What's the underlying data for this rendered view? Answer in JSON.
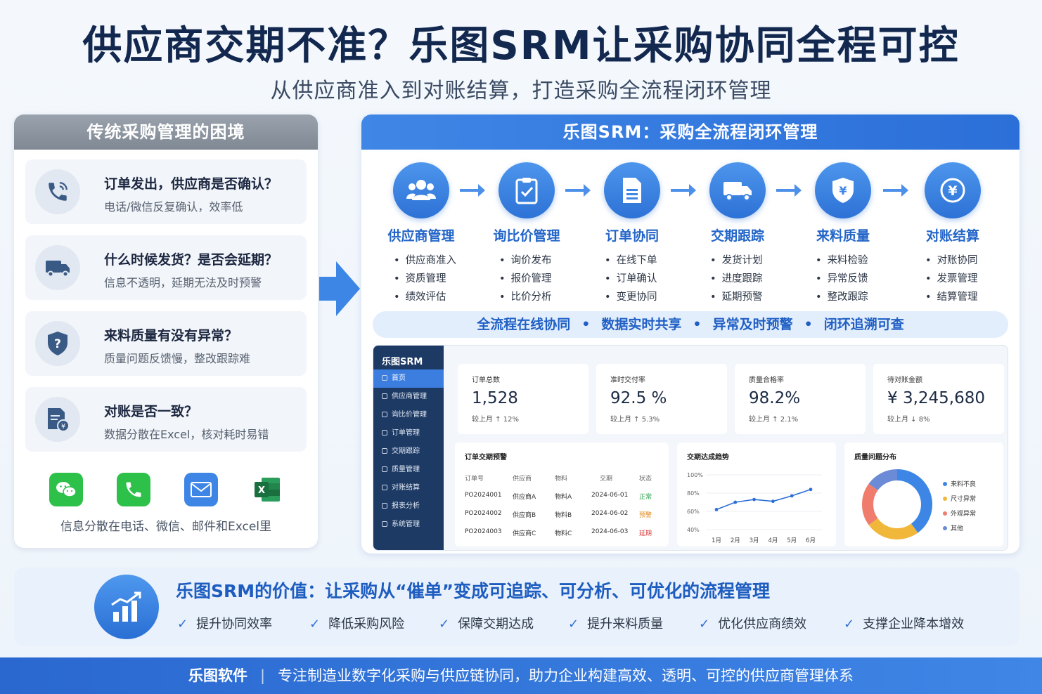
{
  "title": "供应商交期不准？乐图SRM让采购协同全程可控",
  "subtitle": "从供应商准入到对账结算，打造采购全流程闭环管理",
  "left": {
    "header": "传统采购管理的困境",
    "items": [
      {
        "title": "订单发出，供应商是否确认？",
        "desc": "电话/微信反复确认，效率低",
        "icon": "phone-icon"
      },
      {
        "title": "什么时候发货？是否会延期？",
        "desc": "信息不透明，延期无法及时预警",
        "icon": "truck-icon"
      },
      {
        "title": "来料质量有没有异常？",
        "desc": "质量问题反馈慢，整改跟踪难",
        "icon": "shield-question-icon"
      },
      {
        "title": "对账是否一致？",
        "desc": "数据分散在Excel，核对耗时易错",
        "icon": "invoice-icon"
      }
    ],
    "apps_caption": "信息分散在电话、微信、邮件和Excel里",
    "apps": [
      {
        "name": "wechat-icon",
        "color": "#2dc14a"
      },
      {
        "name": "phone-app-icon",
        "color": "#2dc14a"
      },
      {
        "name": "mail-icon",
        "color": "#3d86e6"
      },
      {
        "name": "excel-icon",
        "color": "#1f7a45"
      }
    ]
  },
  "right": {
    "header": "乐图SRM：采购全流程闭环管理",
    "steps": [
      {
        "name": "供应商管理",
        "icon": "users-icon",
        "items": [
          "供应商准入",
          "资质管理",
          "绩效评估"
        ]
      },
      {
        "name": "询比价管理",
        "icon": "clipboard-check-icon",
        "items": [
          "询价发布",
          "报价管理",
          "比价分析"
        ]
      },
      {
        "name": "订单协同",
        "icon": "document-icon",
        "items": [
          "在线下单",
          "订单确认",
          "变更协同"
        ]
      },
      {
        "name": "交期跟踪",
        "icon": "truck-icon",
        "items": [
          "发货计划",
          "进度跟踪",
          "延期预警"
        ]
      },
      {
        "name": "来料质量",
        "icon": "shield-yen-icon",
        "items": [
          "来料检验",
          "异常反馈",
          "整改跟踪"
        ]
      },
      {
        "name": "对账结算",
        "icon": "yen-icon",
        "items": [
          "对账协同",
          "发票管理",
          "结算管理"
        ]
      }
    ],
    "features": [
      "全流程在线协同",
      "数据实时共享",
      "异常及时预警",
      "闭环追溯可查"
    ],
    "feature_sep": "•"
  },
  "dashboard": {
    "logo": "乐图SRM",
    "nav": [
      "首页",
      "供应商管理",
      "询比价管理",
      "订单管理",
      "交期跟踪",
      "质量管理",
      "对账结算",
      "报表分析",
      "系统管理"
    ],
    "kpis": [
      {
        "label": "订单总数",
        "value": "1,528",
        "change": "较上月 ↑ 12%"
      },
      {
        "label": "准时交付率",
        "value": "92.5 %",
        "change": "较上月 ↑ 5.3%"
      },
      {
        "label": "质量合格率",
        "value": "98.2%",
        "change": "较上月 ↑ 2.1%"
      },
      {
        "label": "待对账金额",
        "value": "¥ 3,245,680",
        "change": "较上月 ↓ 8%"
      }
    ],
    "order_panel": {
      "title": "订单交期预警",
      "headers": [
        "订单号",
        "供应商",
        "物料",
        "交期",
        "状态"
      ],
      "rows": [
        [
          "PO2024001",
          "供应商A",
          "物料A",
          "2024-06-01",
          "正常"
        ],
        [
          "PO2024002",
          "供应商B",
          "物料B",
          "2024-06-02",
          "预警"
        ],
        [
          "PO2024003",
          "供应商C",
          "物料C",
          "2024-06-03",
          "延期"
        ]
      ],
      "status_colors": {
        "正常": "#2aa34a",
        "预警": "#e08a1e",
        "延期": "#d93a3a"
      }
    },
    "trend_panel": {
      "title": "交期达成趋势"
    },
    "quality_panel": {
      "title": "质量问题分布"
    }
  },
  "chart_data": [
    {
      "type": "line",
      "title": "交期达成趋势",
      "x": [
        "1月",
        "2月",
        "3月",
        "4月",
        "5月",
        "6月"
      ],
      "y_ticks": [
        "100%",
        "80%",
        "60%",
        "40%"
      ],
      "ylim": [
        40,
        100
      ],
      "values": [
        62,
        70,
        73,
        71,
        77,
        84
      ],
      "color": "#2d6fd6"
    },
    {
      "type": "pie",
      "title": "质量问题分布",
      "labels": [
        "来料不良",
        "尺寸异常",
        "外观异常",
        "其他"
      ],
      "values": [
        40,
        25,
        20,
        15
      ],
      "colors": [
        "#3d86e6",
        "#f0b73a",
        "#ef7c6c",
        "#6c8bd6"
      ]
    }
  ],
  "value": {
    "title": "乐图SRM的价值：让采购从“催单”变成可追踪、可分析、可优化的流程管理",
    "items": [
      "提升协同效率",
      "降低采购风险",
      "保障交期达成",
      "提升来料质量",
      "优化供应商绩效",
      "支撑企业降本增效"
    ]
  },
  "footer": {
    "brand": "乐图软件",
    "sep": "|",
    "text": "专注制造业数字化采购与供应链协同，助力企业构建高效、透明、可控的供应商管理体系"
  }
}
